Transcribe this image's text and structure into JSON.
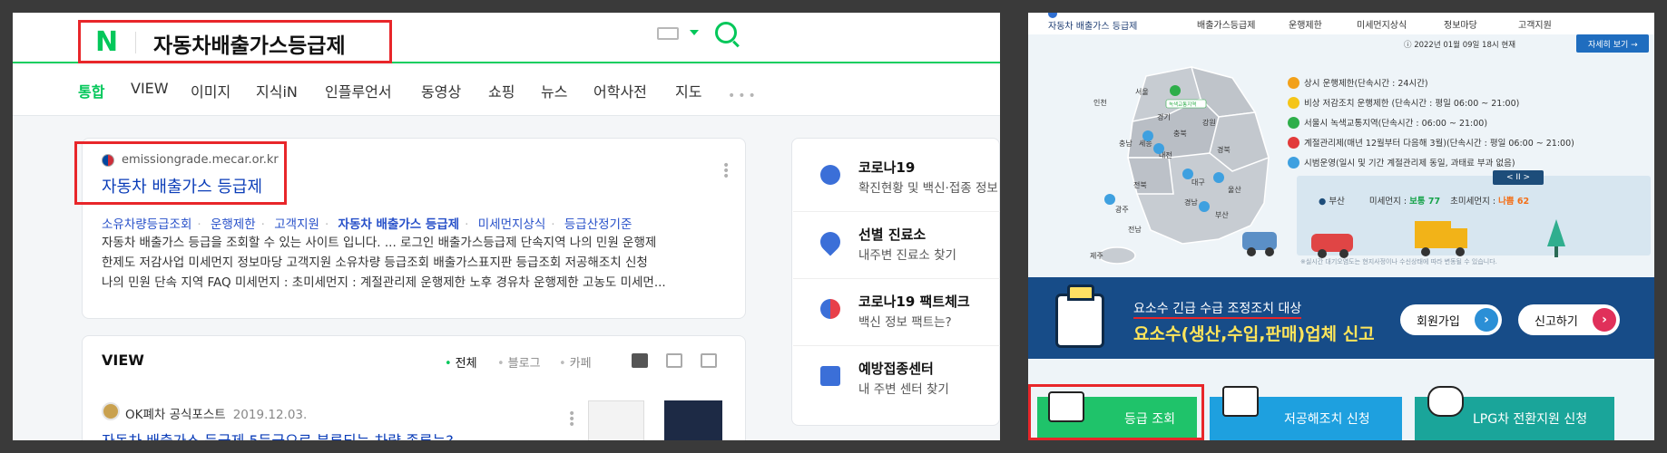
{
  "naver": {
    "logo": "N",
    "query": "자동차배출가스등급제",
    "tabs": [
      {
        "label": "통합",
        "active": true
      },
      {
        "label": "VIEW"
      },
      {
        "label": "이미지"
      },
      {
        "label": "지식iN"
      },
      {
        "label": "인플루언서"
      },
      {
        "label": "동영상"
      },
      {
        "label": "쇼핑"
      },
      {
        "label": "뉴스"
      },
      {
        "label": "어학사전"
      },
      {
        "label": "지도"
      }
    ],
    "more": "•••",
    "result": {
      "url": "emissiongrade.mecar.or.kr",
      "title": "자동차 배출가스 등급제",
      "sitelinks": [
        "소유차량등급조회",
        "운행제한",
        "고객지원",
        "자동차 배출가스 등급제",
        "미세먼지상식",
        "등급산정기준"
      ],
      "snippet_lines": [
        "자동차 배출가스 등급을 조회할 수 있는 사이트 입니다. ... 로그인 배출가스등급제 단속지역 나의 민원 운행제",
        "한제도 저감사업 미세먼지 정보마당 고객지원 소유차량 등급조회 배출가스표지판 등급조회 저공해조치 신청",
        "나의 민원 단속 지역 FAQ 미세먼지 : 초미세먼지 : 계절관리제 운행제한 노후 경유차 운행제한 고농도 미세먼..."
      ]
    },
    "view": {
      "title": "VIEW",
      "filters": [
        "전체",
        "블로그",
        "카페"
      ],
      "author": "OK폐차 공식포스트",
      "date": "2019.12.03.",
      "post_title": "자동차 배출가스 등급제 5등급으로 분류되는 차량 종류는?"
    },
    "side": [
      {
        "title": "코로나19",
        "sub": "확진현황 및 백신·접종 정보",
        "icon": "covid-icon",
        "color": "#3b6fd8"
      },
      {
        "title": "선별 진료소",
        "sub": "내주변 진료소 찾기",
        "icon": "clinic-pin-icon",
        "color": "#3b6fd8"
      },
      {
        "title": "코로나19 팩트체크",
        "sub": "백신 정보 팩트는?",
        "icon": "factcheck-icon",
        "color": "#e8404a"
      },
      {
        "title": "예방접종센터",
        "sub": "내 주변 센터 찾기",
        "icon": "vaccine-center-icon",
        "color": "#3b6fd8"
      }
    ]
  },
  "emission": {
    "logo_text": "자동차 배출가스 등급제",
    "nav": [
      "배출가스등급제",
      "운행제한",
      "미세먼지상식",
      "정보마당",
      "고객지원"
    ],
    "date": "ⓘ 2022년 01월 09일 18시 현재",
    "detail_button": "자세히 보기 →",
    "regions": [
      "서울",
      "인천",
      "경기",
      "강원",
      "충남",
      "세종",
      "충북",
      "대전",
      "경북",
      "전북",
      "대구",
      "울산",
      "경남",
      "광주",
      "부산",
      "전남",
      "제주"
    ],
    "region_badge": "녹색교통지역",
    "legend": [
      {
        "badge": "상시",
        "color": "#f2a11a",
        "text": "상시 운행제한(단속시간 : 24시간)"
      },
      {
        "badge": "비상",
        "color": "#f5c518",
        "text": "비상 저감조치 운행제한 (단속시간 : 평일 06:00 ~ 21:00)"
      },
      {
        "badge": "녹색",
        "color": "#2eae4a",
        "text": "서울시 녹색교통지역(단속시간 : 06:00 ~ 21:00)"
      },
      {
        "badge": "계절",
        "color": "#e23a3a",
        "text": "계절관리제(매년 12월부터 다음해 3월)(단속시간 : 평일 06:00 ~ 21:00)"
      },
      {
        "badge": "시범",
        "color": "#3ea0e0",
        "text": "시범운영(일시 및 기간 계절관리제 동일, 과태료 부과 없음)"
      }
    ],
    "pager": "< II >",
    "dust": {
      "region": "부산",
      "pm10_label": "미세먼지 :",
      "pm10_value": "보통 77",
      "pm25_label": "초미세먼지 :",
      "pm25_value": "나쁨 62"
    },
    "note": "※실시간 대기오염도는 현지사정이나 수신상태에 따라 변동될 수 있습니다.",
    "banner": {
      "line1": "요소수 긴급 수급 조정조치 대상",
      "line2": "요소수(생산,수입,판매)업체 신고",
      "btn_join": "회원가입",
      "btn_report": "신고하기"
    },
    "services": [
      {
        "label": "등급 조회",
        "color": "#1fc36a"
      },
      {
        "label": "저공해조치 신청",
        "color": "#1ea0df"
      },
      {
        "label": "LPG차 전환지원 신청",
        "color": "#1aa59a"
      }
    ]
  }
}
